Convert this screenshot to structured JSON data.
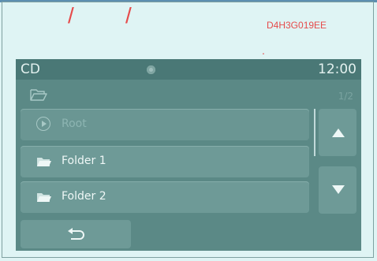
{
  "annotations": {
    "slash_a": "/",
    "slash_b": "/",
    "image_code": "D4H3G019EE",
    "dot": "."
  },
  "status_bar": {
    "source": "CD",
    "time": "12:00"
  },
  "browser": {
    "page_indicator": "1/2",
    "rows": [
      {
        "label": "Root",
        "icon": "play-circle-icon",
        "dimmed": true
      },
      {
        "label": "Folder 1",
        "icon": "folder-icon"
      },
      {
        "label": "Folder 2",
        "icon": "folder-icon"
      }
    ]
  },
  "icons": {
    "path": "open-folder-icon",
    "scroll_up": "triangle-up-icon",
    "scroll_down": "triangle-down-icon",
    "back": "back-arrow-icon"
  },
  "colors": {
    "screen_bg": "#5b8986",
    "button_bg": "#6e9a97",
    "text": "#eef7f6",
    "annotation_red": "#e64b4b"
  }
}
